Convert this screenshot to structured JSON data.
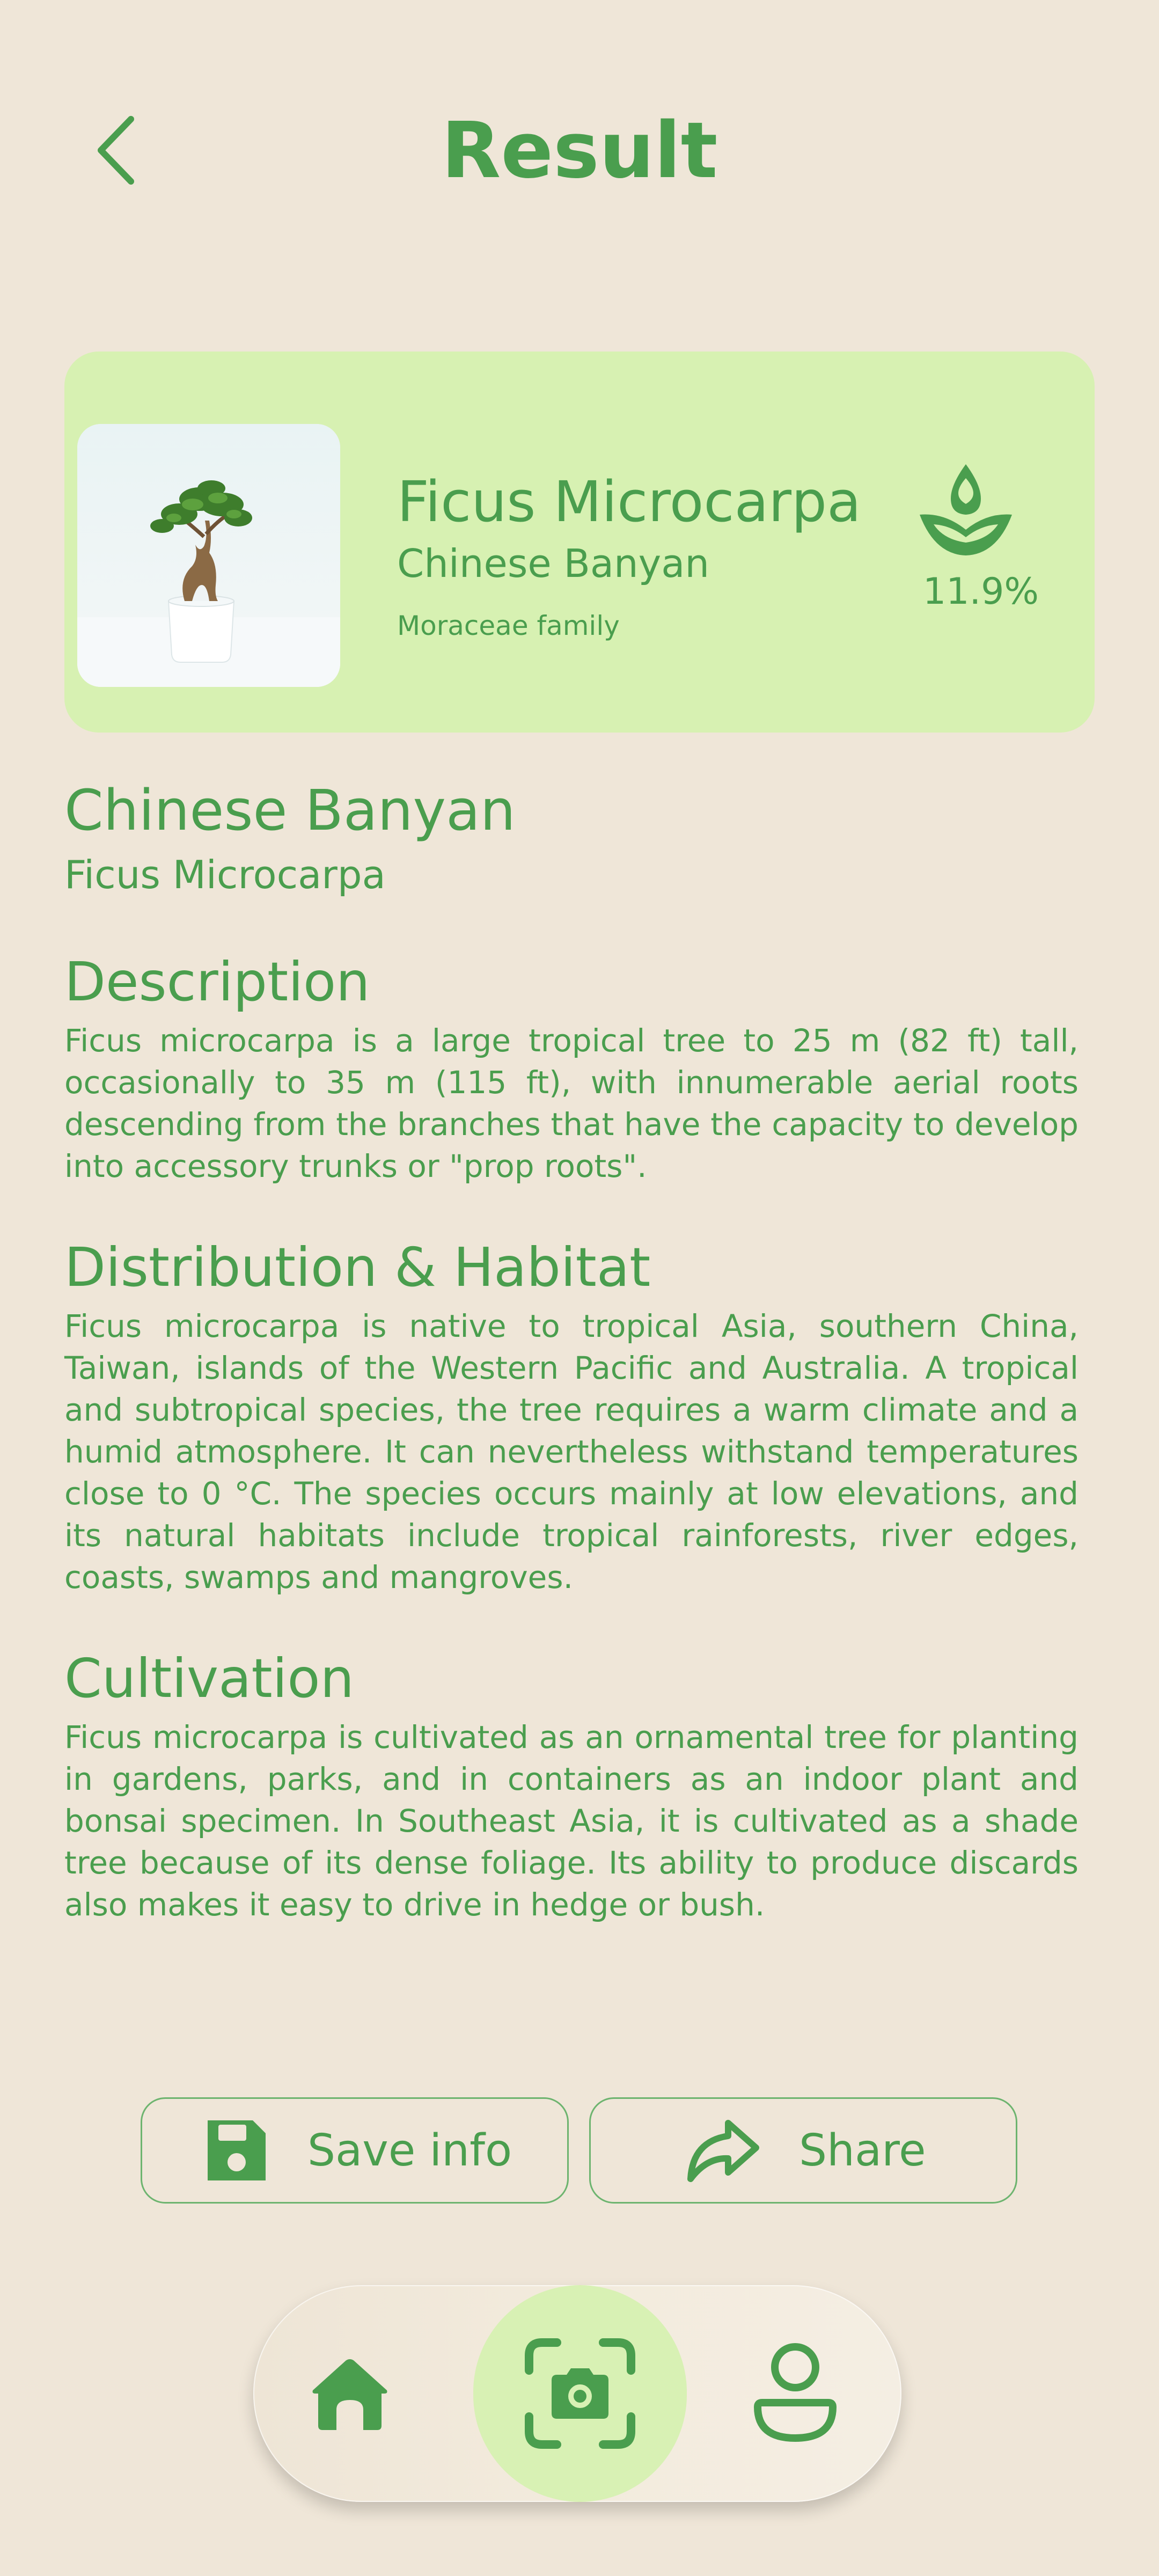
{
  "header": {
    "title": "Result",
    "back_icon": "chevron-left-icon"
  },
  "summary": {
    "scientific_name": "Ficus Microcarpa",
    "common_name": "Chinese Banyan",
    "family": "Moraceae family",
    "confidence": "11.9%",
    "confidence_icon": "sprout-icon"
  },
  "details": {
    "common_name": "Chinese Banyan",
    "scientific_name": "Ficus Microcarpa",
    "sections": [
      {
        "title": "Description",
        "body": "Ficus microcarpa is a large tropical tree to 25 m (82 ft) tall, occasionally to 35 m (115 ft), with innumerable aerial roots descending from the branches that have the capacity to develop into accessory trunks or \"prop roots\"."
      },
      {
        "title": "Distribution & Habitat",
        "body": "Ficus microcarpa is native to tropical Asia, southern China, Taiwan, islands of the Western Pacific and Australia. A tropical and subtropical species, the tree requires a warm climate and a humid atmosphere. It can nevertheless withstand temperatures close to 0 °C. The species occurs mainly at low elevations, and its natural habitats include tropical rainforests, river edges, coasts, swamps and mangroves."
      },
      {
        "title": "Cultivation",
        "body": "Ficus microcarpa is cultivated as an ornamental tree for planting in gardens, parks, and in containers as an indoor plant and bonsai specimen. In Southeast Asia, it is cultivated as a shade tree because of its dense foliage. Its ability to produce discards also makes it easy to drive in hedge or bush."
      }
    ]
  },
  "actions": {
    "save_label": "Save info",
    "save_icon": "floppy-disk-icon",
    "share_label": "Share",
    "share_icon": "share-arrow-icon"
  },
  "nav": {
    "items": [
      "home-icon",
      "camera-scan-icon",
      "profile-icon"
    ],
    "active": "camera-scan-icon"
  },
  "colors": {
    "background": "#EFE6D8",
    "primary_green": "#4A9E4E",
    "card_green": "#D7F1B2",
    "nav_active": "#D8F1B4"
  }
}
